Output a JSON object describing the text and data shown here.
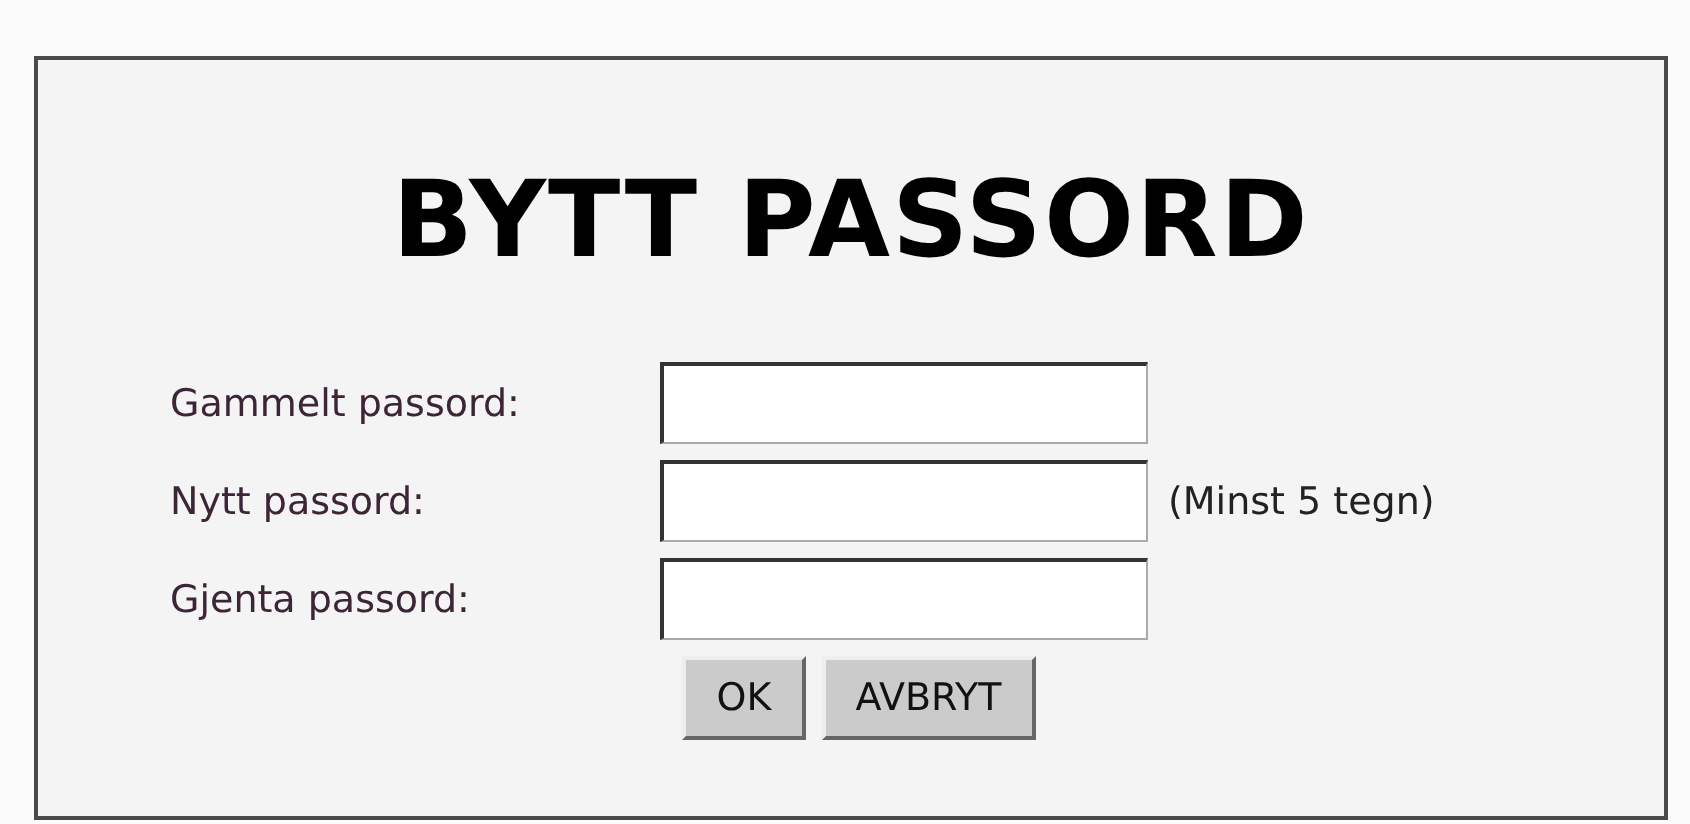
{
  "title": "BYTT PASSORD",
  "fields": [
    {
      "label": "Gammelt passord:"
    },
    {
      "label": "Nytt passord:",
      "hint": "(Minst 5 tegn)"
    },
    {
      "label": "Gjenta passord:"
    }
  ],
  "buttons": [
    "OK",
    "AVBRYT"
  ]
}
